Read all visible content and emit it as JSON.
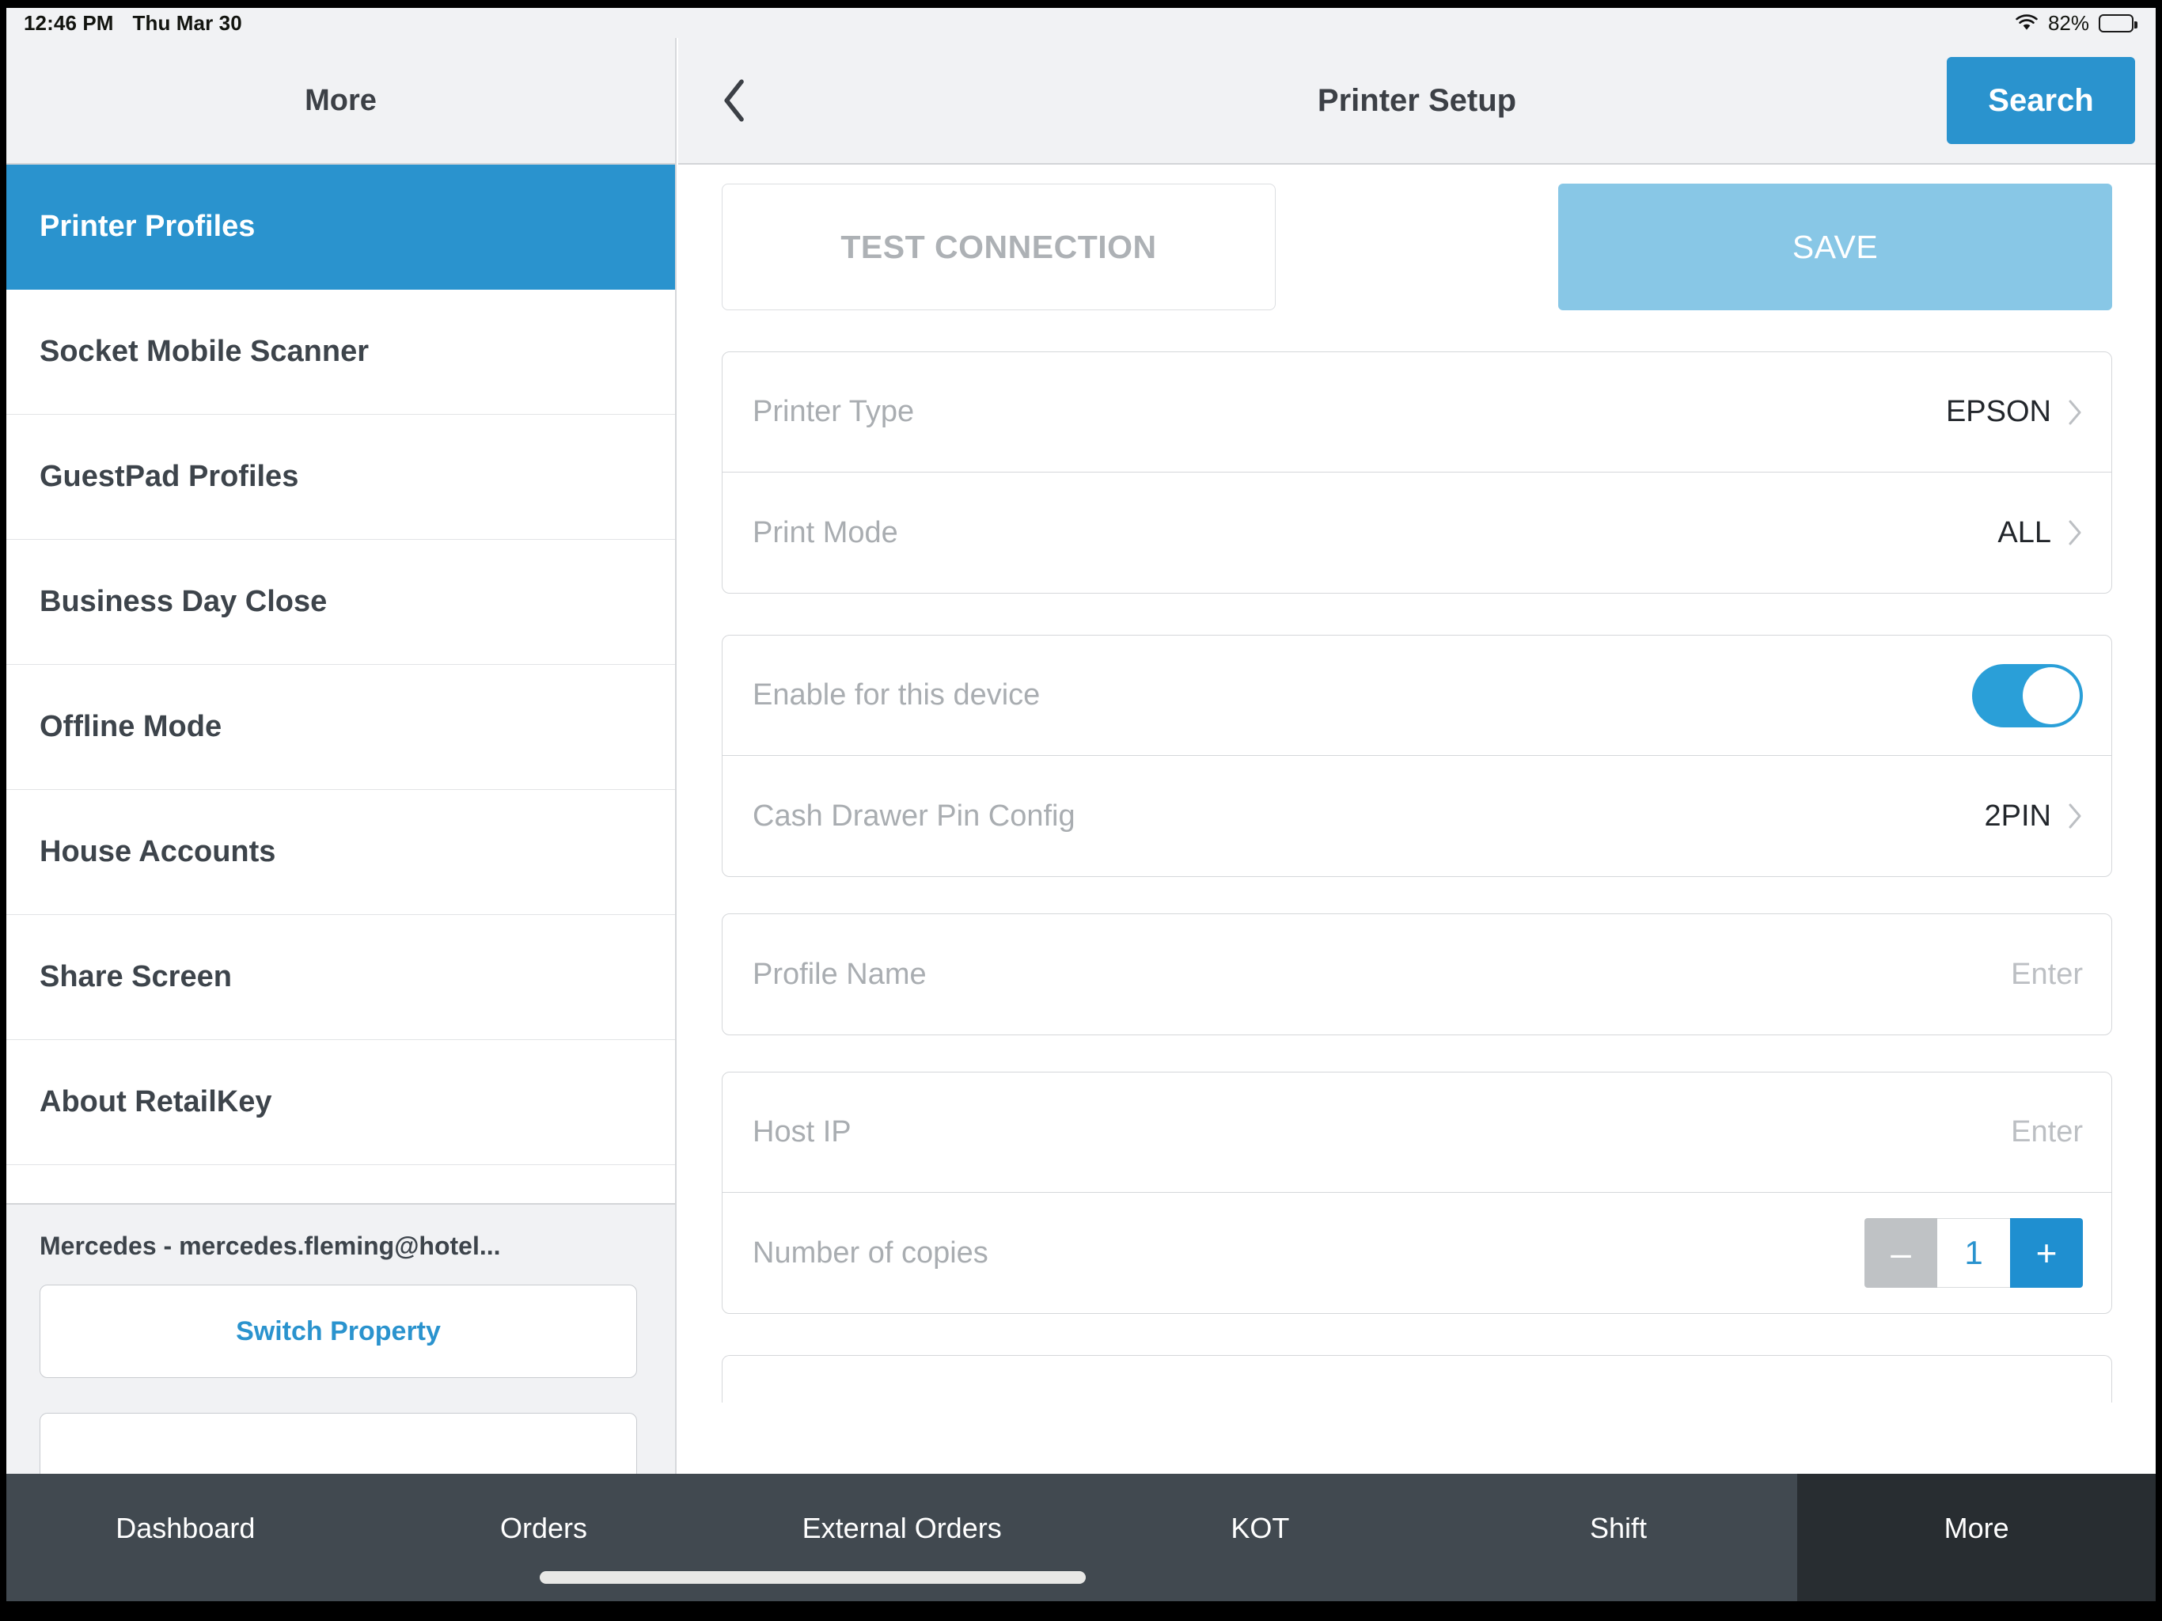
{
  "status_bar": {
    "time": "12:46 PM",
    "date": "Thu Mar 30",
    "wifi_icon": "wifi-icon",
    "battery_percent": "82%",
    "battery_icon": "battery-full-icon"
  },
  "sidebar": {
    "header_title": "More",
    "items": [
      {
        "label": "Printer Profiles",
        "active": true
      },
      {
        "label": "Socket Mobile Scanner",
        "active": false
      },
      {
        "label": "GuestPad Profiles",
        "active": false
      },
      {
        "label": "Business Day Close",
        "active": false
      },
      {
        "label": "Offline Mode",
        "active": false
      },
      {
        "label": "House Accounts",
        "active": false
      },
      {
        "label": "Share Screen",
        "active": false
      },
      {
        "label": "About RetailKey",
        "active": false
      }
    ],
    "account_label": "Mercedes - mercedes.fleming@hotel...",
    "switch_property_label": "Switch Property"
  },
  "main": {
    "back_icon": "chevron-left-icon",
    "title": "Printer Setup",
    "search_label": "Search",
    "test_connection_label": "TEST CONNECTION",
    "save_label": "SAVE",
    "groups": [
      {
        "rows": [
          {
            "label": "Printer Type",
            "value": "EPSON",
            "type": "chevron"
          },
          {
            "label": "Print Mode",
            "value": "ALL",
            "type": "chevron"
          }
        ]
      },
      {
        "rows": [
          {
            "label": "Enable for this device",
            "value": "on",
            "type": "toggle"
          },
          {
            "label": "Cash Drawer Pin Config",
            "value": "2PIN",
            "type": "chevron"
          }
        ]
      },
      {
        "rows": [
          {
            "label": "Profile Name",
            "value": "",
            "placeholder": "Enter",
            "type": "text"
          }
        ]
      },
      {
        "rows": [
          {
            "label": "Host IP",
            "value": "",
            "placeholder": "Enter",
            "type": "text"
          },
          {
            "label": "Number of copies",
            "value": "1",
            "type": "stepper",
            "minus_label": "–",
            "plus_label": "+"
          }
        ]
      }
    ]
  },
  "tabbar": {
    "tabs": [
      {
        "label": "Dashboard",
        "active": false
      },
      {
        "label": "Orders",
        "active": false
      },
      {
        "label": "External Orders",
        "active": false
      },
      {
        "label": "KOT",
        "active": false
      },
      {
        "label": "Shift",
        "active": false
      },
      {
        "label": "More",
        "active": true
      }
    ]
  },
  "colors": {
    "accent": "#2a93ce",
    "accent_light": "#88c7e6",
    "toggle_on": "#2a9fd8",
    "tabbar_bg": "#414950",
    "tabbar_active_bg": "#282d31",
    "header_bg": "#f1f2f4",
    "label_grey": "#a9adb1"
  }
}
